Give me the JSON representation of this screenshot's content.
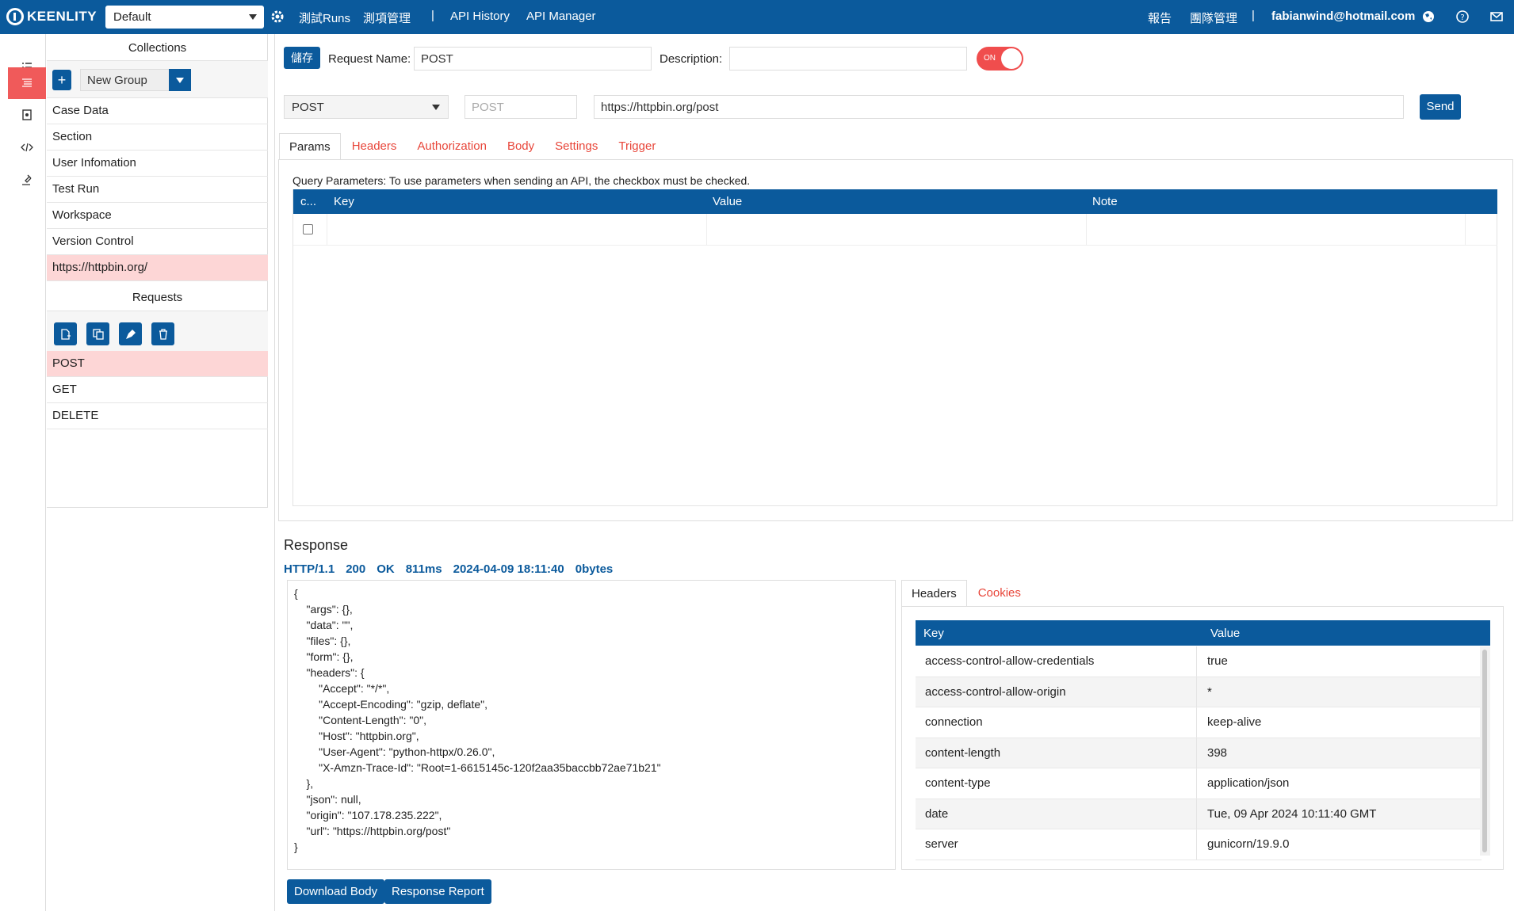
{
  "topbar": {
    "brand": "KEENLITY",
    "workspace": "Default",
    "nav": [
      "測試Runs",
      "測項管理",
      "|",
      "API History",
      "API Manager"
    ],
    "right": [
      "報告",
      "團隊管理",
      "|",
      "fabianwind@hotmail.com"
    ]
  },
  "collections": {
    "title": "Collections",
    "add_label": "+",
    "group_select": "New Group",
    "items": [
      "Case Data",
      "Section",
      "User Infomation",
      "Test Run",
      "Workspace",
      "Version Control",
      "https://httpbin.org/"
    ],
    "selected": "https://httpbin.org/"
  },
  "requests": {
    "title": "Requests",
    "items": [
      "POST",
      "GET",
      "DELETE"
    ],
    "selected": "POST"
  },
  "request": {
    "save_label": "儲存",
    "name_label": "Request Name:",
    "name_value": "POST",
    "description_label": "Description:",
    "description_value": "",
    "toggle_label": "ON",
    "method": "POST",
    "method_placeholder": "POST",
    "url": "https://httpbin.org/post",
    "send_label": "Send"
  },
  "tabs": [
    "Params",
    "Headers",
    "Authorization",
    "Body",
    "Settings",
    "Trigger"
  ],
  "params": {
    "note": "Query Parameters: To use parameters when sending an API, the checkbox must be checked.",
    "columns": [
      "c...",
      "Key",
      "Value",
      "Note"
    ]
  },
  "response": {
    "title": "Response",
    "status": [
      "HTTP/1.1",
      "200",
      "OK",
      "811ms",
      "2024-04-09 18:11:40",
      "0bytes"
    ],
    "body": "{\n    \"args\": {},\n    \"data\": \"\",\n    \"files\": {},\n    \"form\": {},\n    \"headers\": {\n        \"Accept\": \"*/*\",\n        \"Accept-Encoding\": \"gzip, deflate\",\n        \"Content-Length\": \"0\",\n        \"Host\": \"httpbin.org\",\n        \"User-Agent\": \"python-httpx/0.26.0\",\n        \"X-Amzn-Trace-Id\": \"Root=1-6615145c-120f2aa35baccbb72ae71b21\"\n    },\n    \"json\": null,\n    \"origin\": \"107.178.235.222\",\n    \"url\": \"https://httpbin.org/post\"\n}",
    "header_tabs": [
      "Headers",
      "Cookies"
    ],
    "columns": [
      "Key",
      "Value"
    ],
    "headers": [
      {
        "key": "access-control-allow-credentials",
        "value": "true"
      },
      {
        "key": "access-control-allow-origin",
        "value": "*"
      },
      {
        "key": "connection",
        "value": "keep-alive"
      },
      {
        "key": "content-length",
        "value": "398"
      },
      {
        "key": "content-type",
        "value": "application/json"
      },
      {
        "key": "date",
        "value": "Tue, 09 Apr 2024 10:11:40 GMT"
      },
      {
        "key": "server",
        "value": "gunicorn/19.9.0"
      }
    ],
    "download_label": "Download Body",
    "report_label": "Response Report"
  },
  "colors": {
    "primary": "#0b5a9c",
    "accent": "#f04d4d",
    "selected_row": "#fdd6d6"
  }
}
